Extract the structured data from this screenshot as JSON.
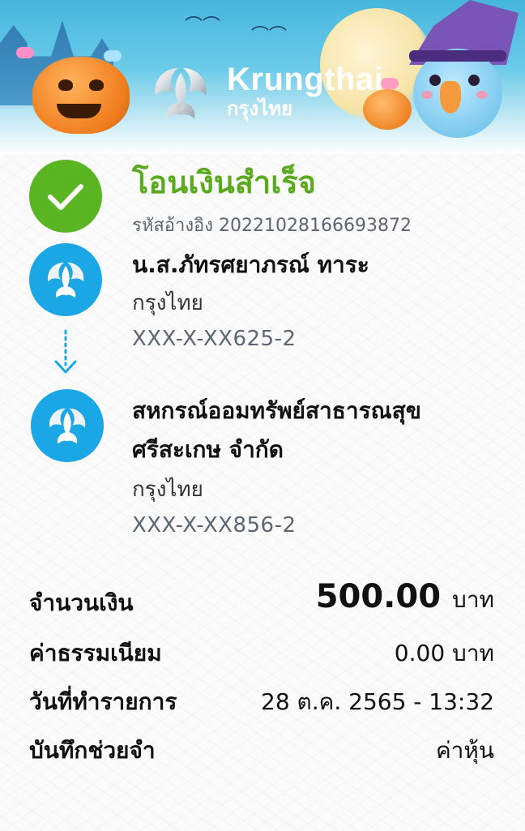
{
  "brand": {
    "name_en": "Krungthai",
    "name_th": "กรุงไทย"
  },
  "status": {
    "title": "โอนเงินสำเร็จ",
    "reference": "รหัสอ้างอิง 2022102816669387​2",
    "color": "#5aaa1e"
  },
  "sender": {
    "name": "น.ส.ภัทรศยาภรณ์ ทาระ",
    "bank": "กรุงไทย",
    "account": "XXX-X-XX625-2"
  },
  "receiver": {
    "name_line1": "สหกรณ์ออมทรัพย์สาธารณสุข",
    "name_line2": "ศรีสะเกษ จำกัด",
    "bank": "กรุงไทย",
    "account": "XXX-X-XX856-2"
  },
  "details": {
    "amount_label": "จำนวนเงิน",
    "amount_value": "500.00",
    "amount_unit": "บาท",
    "fee_label": "ค่าธรรมเนียม",
    "fee_value": "0.00 บาท",
    "date_label": "วันที่ทำรายการ",
    "date_value": "28 ต.ค. 2565 - 13:32",
    "memo_label": "บันทึกช่วยจำ",
    "memo_value": "ค่าหุ้น"
  },
  "icons": {
    "status": "check-icon",
    "bank": "krungthai-logo-icon",
    "transfer": "arrow-down-icon"
  },
  "colors": {
    "success_green": "#5ab523",
    "bank_blue": "#1ba6e6"
  }
}
